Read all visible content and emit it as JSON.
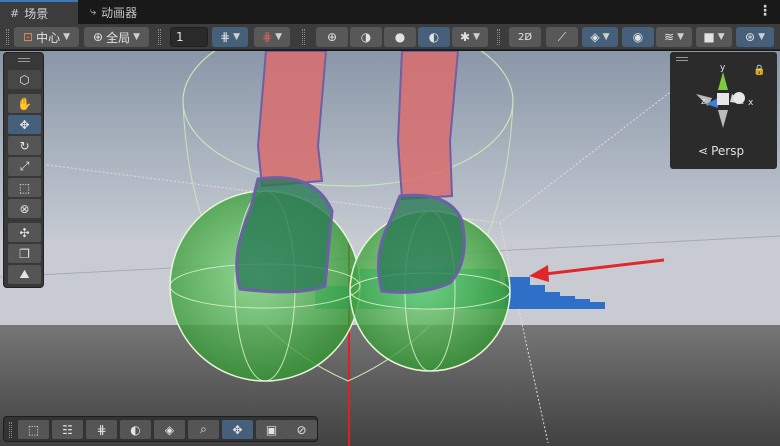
{
  "tabs": [
    {
      "label": "场景",
      "icon": "grid-icon",
      "active": true
    },
    {
      "label": "动画器",
      "icon": "animator-icon",
      "active": false
    }
  ],
  "toolbar": {
    "pivot_label": "中心",
    "space_label": "全局",
    "grid_value": "1"
  },
  "gizmo": {
    "axis_x": "x",
    "axis_y": "y",
    "axis_z": "z",
    "projection_label": "Persp"
  },
  "colors": {
    "panel": "#3c3c3c",
    "button": "#585858",
    "active_button": "#46607c",
    "accent_tab": "#3a79bb",
    "arrow_red": "#e0272b"
  }
}
